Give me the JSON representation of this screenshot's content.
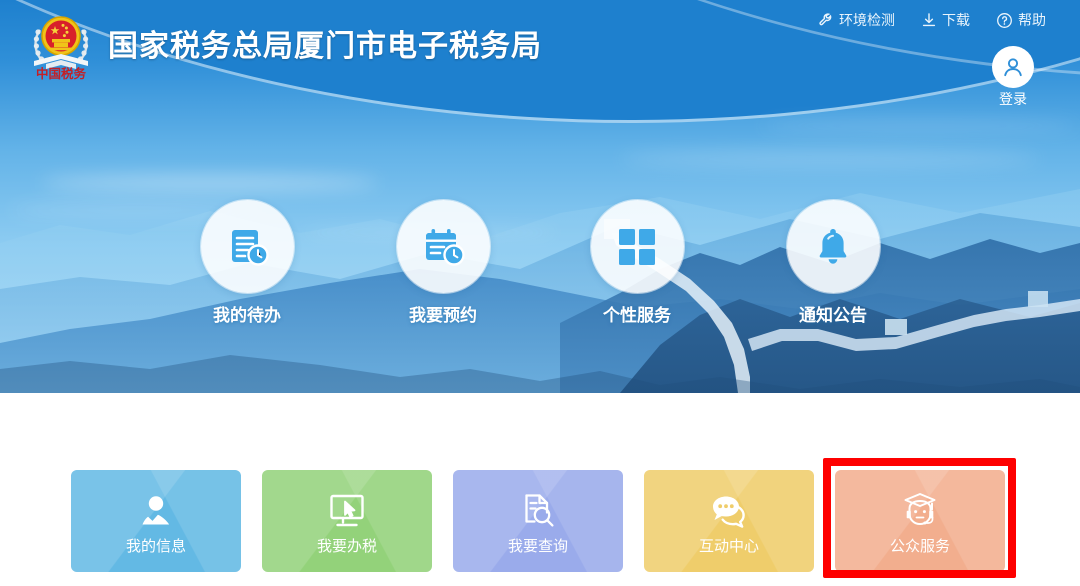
{
  "header": {
    "site_title": "国家税务总局厦门市电子税务局",
    "emblem_name": "china-taxation-emblem",
    "emblem_text": "中国税务",
    "links": [
      {
        "label": "环境检测",
        "icon": "wrench-icon"
      },
      {
        "label": "下载",
        "icon": "download-icon"
      },
      {
        "label": "帮助",
        "icon": "question-circle-icon"
      }
    ],
    "user": {
      "label": "登录",
      "icon": "user-avatar-icon"
    }
  },
  "shortcuts": [
    {
      "label": "我的待办",
      "icon": "document-clock-icon"
    },
    {
      "label": "我要预约",
      "icon": "calendar-clock-icon"
    },
    {
      "label": "个性服务",
      "icon": "grid-squares-icon"
    },
    {
      "label": "通知公告",
      "icon": "bell-icon"
    }
  ],
  "tiles": [
    {
      "label": "我的信息",
      "icon": "person-icon",
      "color": "#63b9e4"
    },
    {
      "label": "我要办税",
      "icon": "monitor-cursor-icon",
      "color": "#93d27a"
    },
    {
      "label": "我要查询",
      "icon": "document-search-icon",
      "color": "#9aabeb"
    },
    {
      "label": "互动中心",
      "icon": "chat-bubbles-icon",
      "color": "#efcd6b"
    },
    {
      "label": "公众服务",
      "icon": "graduate-headset-icon",
      "color": "#f2ae8e"
    }
  ],
  "annotation": {
    "type": "highlight-box",
    "target": "公众服务",
    "color": "#fe0000"
  },
  "theme": {
    "header_blue": "#1e80ce",
    "sky_light": "#bae2f8",
    "icon_blue": "#3fa9e8",
    "page_background": "#ffffff"
  }
}
